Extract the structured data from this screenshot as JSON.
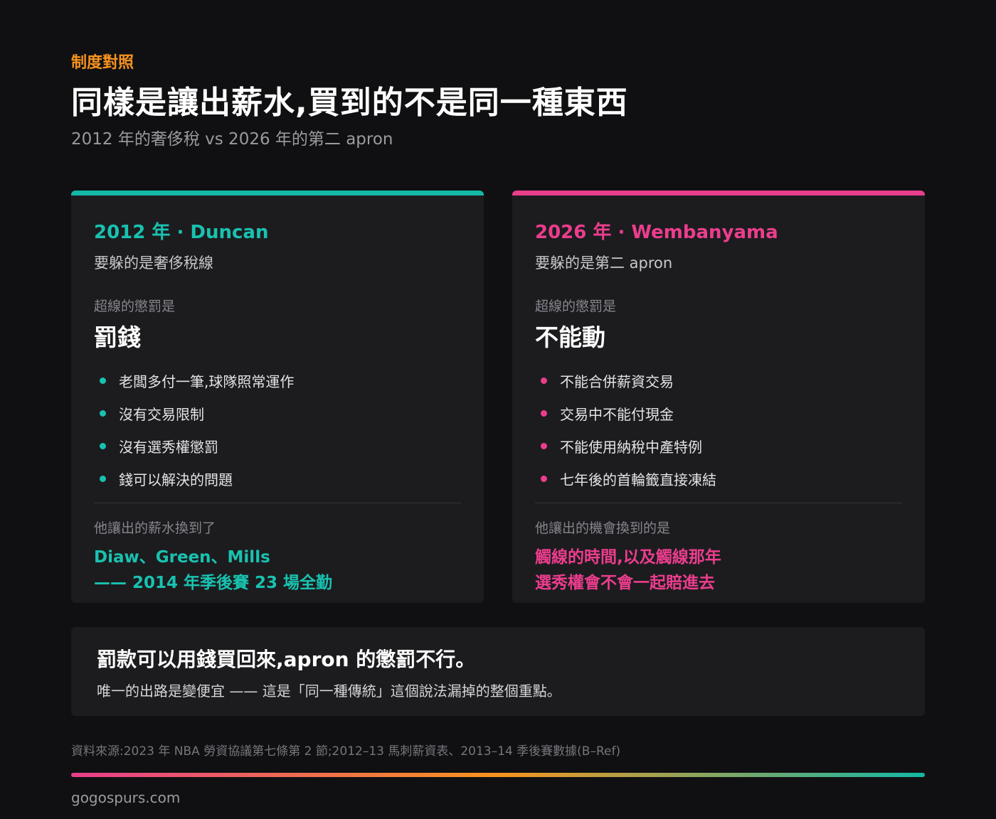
{
  "header": {
    "eyebrow": "制度對照",
    "title": "同樣是讓出薪水,買到的不是同一種東西",
    "subtitle": "2012 年的奢侈稅 vs 2026 年的第二 apron"
  },
  "cards": [
    {
      "accent": "#19c2b0",
      "year_label": "2012 年 · Duncan",
      "avoid": "要躲的是奢侈稅線",
      "penalty_label": "超線的懲罰是",
      "penalty": "罰錢",
      "items": [
        "老闆多付一筆,球隊照常運作",
        "沒有交易限制",
        "沒有選秀權懲罰",
        "錢可以解決的問題"
      ],
      "trade_label": "他讓出的薪水換到了",
      "result_lines": [
        "Diaw、Green、Mills",
        "—— 2014 年季後賽 23 場全勤"
      ]
    },
    {
      "accent": "#ec3d8d",
      "year_label": "2026 年 · Wembanyama",
      "avoid": "要躲的是第二 apron",
      "penalty_label": "超線的懲罰是",
      "penalty": "不能動",
      "items": [
        "不能合併薪資交易",
        "交易中不能付現金",
        "不能使用納稅中產特例",
        "七年後的首輪籤直接凍結"
      ],
      "trade_label": "他讓出的機會換到的是",
      "result_lines": [
        "觸線的時間,以及觸線那年",
        "選秀權會不會一起賠進去"
      ]
    }
  ],
  "summary": {
    "main": "罰款可以用錢買回來,apron 的懲罰不行。",
    "sub": "唯一的出路是變便宜 —— 這是「同一種傳統」這個說法漏掉的整個重點。"
  },
  "footer": {
    "source": "資料來源:2023 年 NBA 勞資協議第七條第 2 節;2012–13 馬刺薪資表、2013–14 季後賽數據(B–Ref)",
    "site": "gogospurs.com"
  }
}
